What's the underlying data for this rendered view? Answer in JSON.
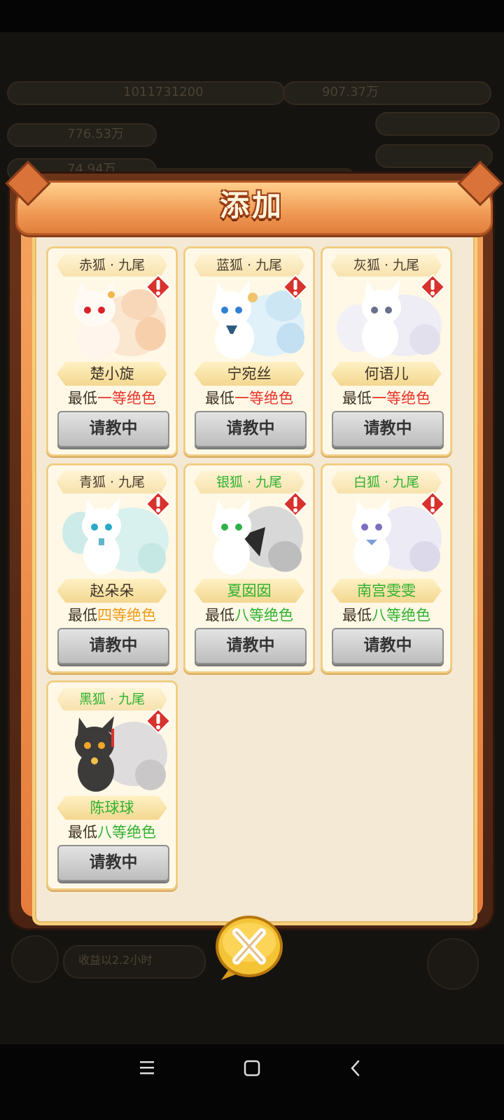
{
  "background": {
    "top_left_value": "1011731200",
    "top_right_value": "907.37万",
    "row2_left_value": "776.53万",
    "row3_left_value": "74.94万",
    "bottom_pill_text": "收益以2.2小时"
  },
  "dialog": {
    "title": "添加"
  },
  "cards": [
    {
      "tag": "赤狐 · 九尾",
      "name": "楚小旋",
      "min_prefix": "最低",
      "min_grade": "一等绝色",
      "button": "请教中",
      "fox_color": "#f7d6b8",
      "grade_color": "red",
      "tag_color": "dark",
      "name_color": "dark"
    },
    {
      "tag": "蓝狐 · 九尾",
      "name": "宁宛丝",
      "min_prefix": "最低",
      "min_grade": "一等绝色",
      "button": "请教中",
      "fox_color": "#cfe6f3",
      "grade_color": "red",
      "tag_color": "dark",
      "name_color": "dark"
    },
    {
      "tag": "灰狐 · 九尾",
      "name": "何语儿",
      "min_prefix": "最低",
      "min_grade": "一等绝色",
      "button": "请教中",
      "fox_color": "#e6e4ee",
      "grade_color": "red",
      "tag_color": "dark",
      "name_color": "dark"
    },
    {
      "tag": "青狐 · 九尾",
      "name": "赵朵朵",
      "min_prefix": "最低",
      "min_grade": "四等绝色",
      "button": "请教中",
      "fox_color": "#d3efec",
      "grade_color": "orange",
      "tag_color": "dark",
      "name_color": "dark"
    },
    {
      "tag": "银狐 · 九尾",
      "name": "夏囡囡",
      "min_prefix": "最低",
      "min_grade": "八等绝色",
      "button": "请教中",
      "fox_color": "#cfcfcf",
      "grade_color": "green",
      "tag_color": "green",
      "name_color": "green"
    },
    {
      "tag": "白狐 · 九尾",
      "name": "南宫雯雯",
      "min_prefix": "最低",
      "min_grade": "八等绝色",
      "button": "请教中",
      "fox_color": "#eceaf4",
      "grade_color": "green",
      "tag_color": "green",
      "name_color": "green"
    },
    {
      "tag": "黑狐 · 九尾",
      "name": "陈球球",
      "min_prefix": "最低",
      "min_grade": "八等绝色",
      "button": "请教中",
      "fox_color": "#3c3a3a",
      "grade_color": "green",
      "tag_color": "green",
      "name_color": "green"
    }
  ],
  "icons": {
    "alert": "exclamation-alert-icon",
    "close": "close-x-icon",
    "nav_menu": "menu-icon",
    "nav_home": "home-square-icon",
    "nav_back": "back-chevron-icon"
  },
  "colors": {
    "grade_red": "#e8322a",
    "grade_orange": "#f09a18",
    "grade_green": "#2fb12f",
    "panel_bg": "#f3e9d4",
    "banner_orange": "#f09a55"
  }
}
